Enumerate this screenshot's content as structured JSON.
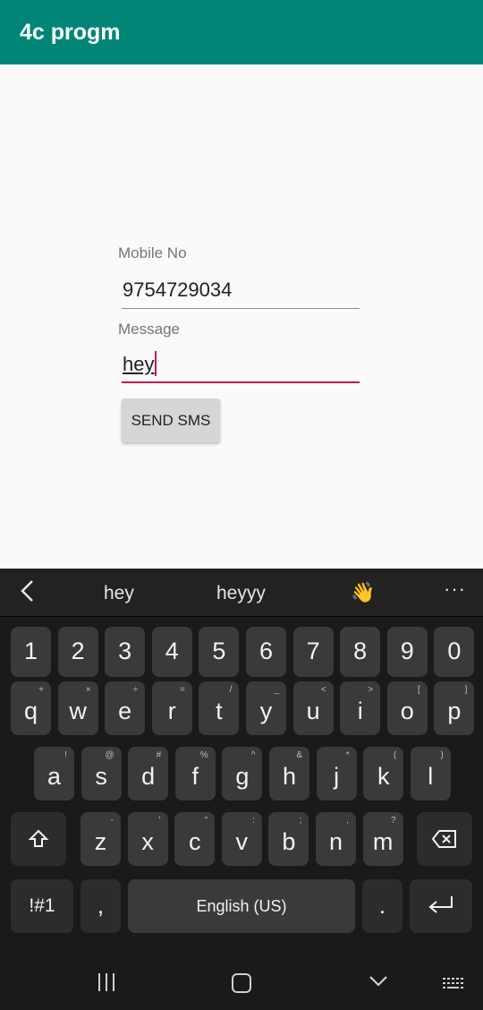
{
  "app": {
    "title": "4c progm"
  },
  "form": {
    "mobile_label": "Mobile No",
    "mobile_value": "9754729034",
    "message_label": "Message",
    "message_value": "hey",
    "send_label": "SEND SMS"
  },
  "keyboard": {
    "suggestions": [
      "hey",
      "heyyy"
    ],
    "suggestion_emoji": "👋",
    "more_icon": "···",
    "back_icon": "chevron-left-icon",
    "row_numbers": [
      "1",
      "2",
      "3",
      "4",
      "5",
      "6",
      "7",
      "8",
      "9",
      "0"
    ],
    "row_qwerty": [
      {
        "key": "q",
        "sub": "+"
      },
      {
        "key": "w",
        "sub": "×"
      },
      {
        "key": "e",
        "sub": "÷"
      },
      {
        "key": "r",
        "sub": "="
      },
      {
        "key": "t",
        "sub": "/"
      },
      {
        "key": "y",
        "sub": "_"
      },
      {
        "key": "u",
        "sub": "<"
      },
      {
        "key": "i",
        "sub": ">"
      },
      {
        "key": "o",
        "sub": "["
      },
      {
        "key": "p",
        "sub": "]"
      }
    ],
    "row_asdf": [
      {
        "key": "a",
        "sub": "!"
      },
      {
        "key": "s",
        "sub": "@"
      },
      {
        "key": "d",
        "sub": "#"
      },
      {
        "key": "f",
        "sub": "%"
      },
      {
        "key": "g",
        "sub": "^"
      },
      {
        "key": "h",
        "sub": "&"
      },
      {
        "key": "j",
        "sub": "*"
      },
      {
        "key": "k",
        "sub": "("
      },
      {
        "key": "l",
        "sub": ")"
      }
    ],
    "row_zxcv": [
      {
        "key": "z",
        "sub": "-"
      },
      {
        "key": "x",
        "sub": "'"
      },
      {
        "key": "c",
        "sub": "\""
      },
      {
        "key": "v",
        "sub": ":"
      },
      {
        "key": "b",
        "sub": ";"
      },
      {
        "key": "n",
        "sub": ","
      },
      {
        "key": "m",
        "sub": "?"
      }
    ],
    "symbols_label": "!#1",
    "comma_label": ",",
    "space_label": "English (US)",
    "period_label": ".",
    "shift_icon": "shift-icon",
    "backspace_icon": "backspace-icon",
    "enter_icon": "enter-icon"
  },
  "navbar": {
    "recents_icon": "recents-icon",
    "home_icon": "home-icon",
    "back_icon": "chevron-down-icon",
    "keyboard_icon": "keyboard-icon"
  }
}
